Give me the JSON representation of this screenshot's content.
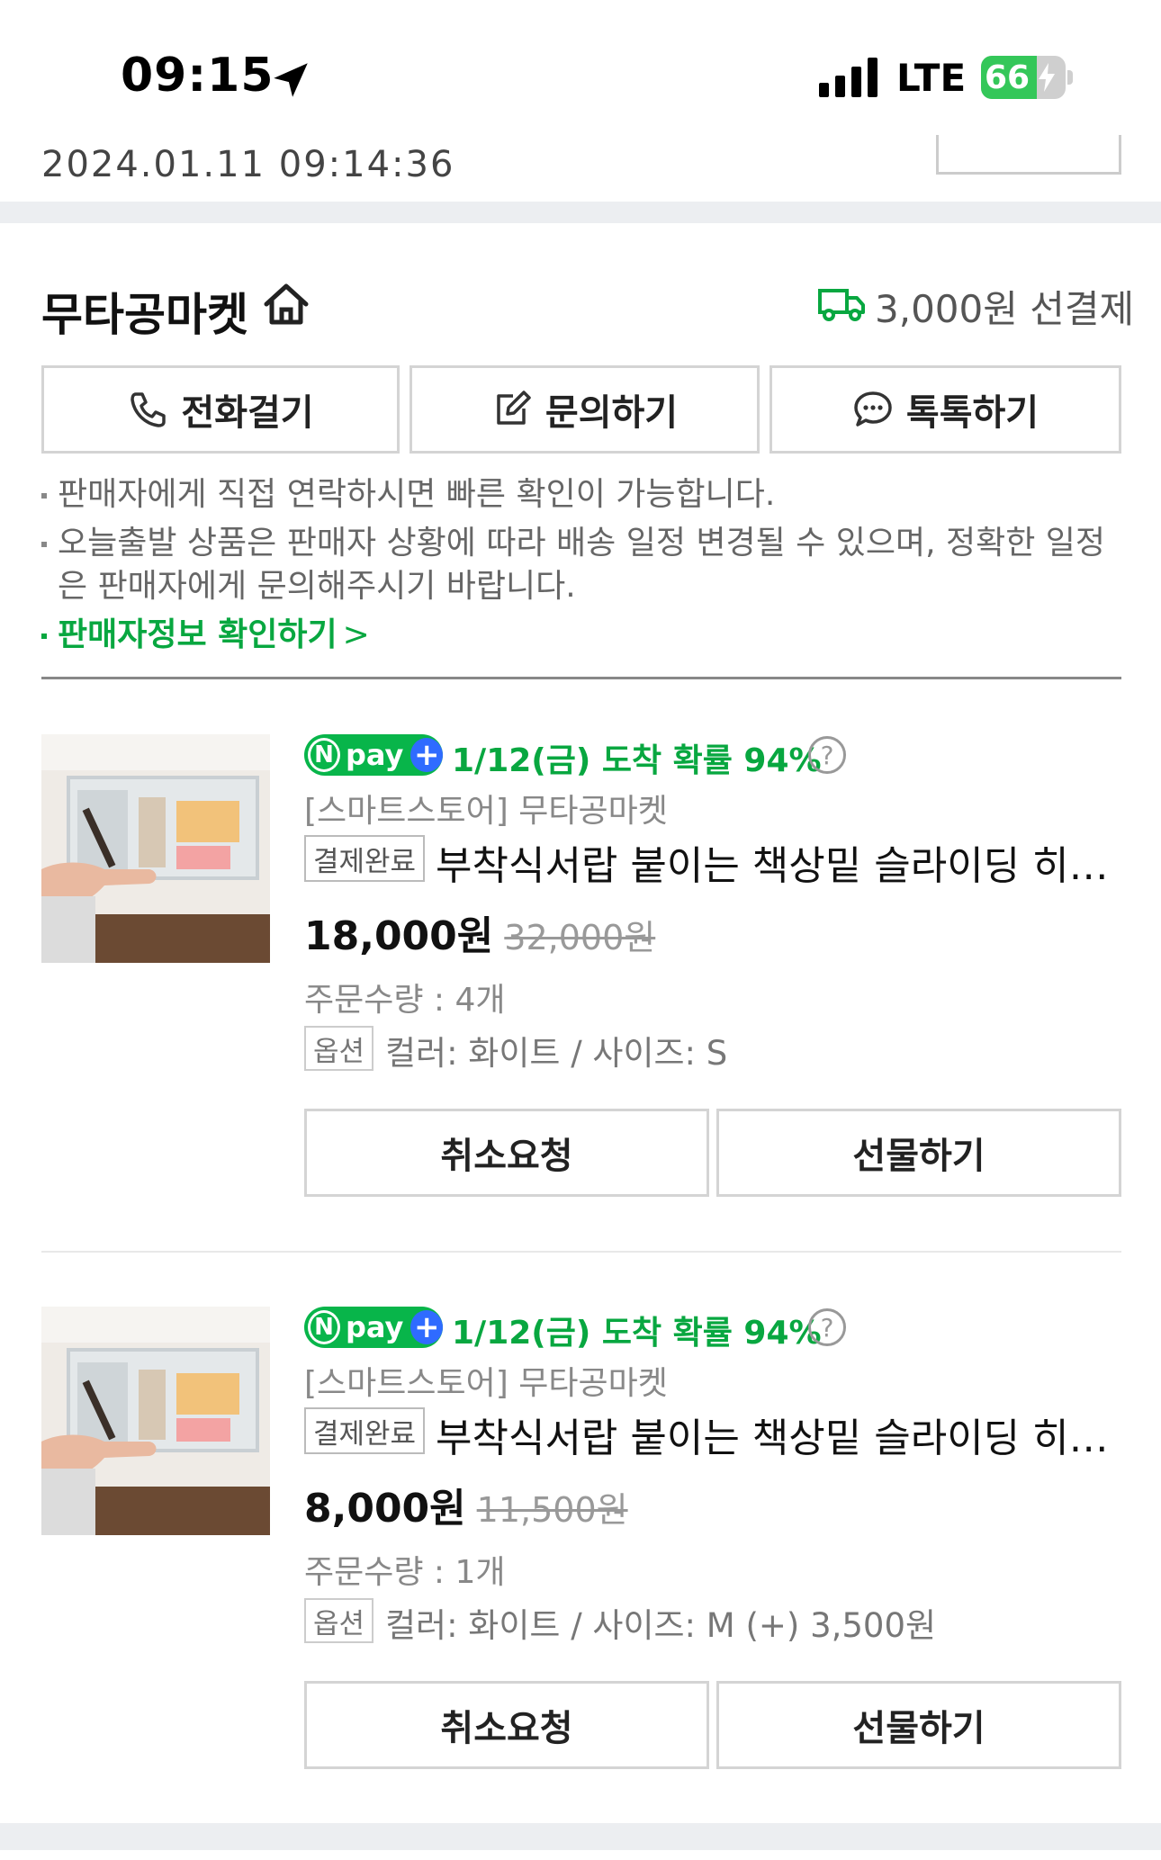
{
  "status_bar": {
    "time": "09:15",
    "network": "LTE",
    "battery": "66",
    "battery_level": 0.66
  },
  "previous": {
    "order_date": "2024.01.11 09:14:36"
  },
  "store": {
    "name": "무타공마켓",
    "shipping": "3,000원 선결제"
  },
  "contact_buttons": {
    "call": "전화걸기",
    "inquiry": "문의하기",
    "talk": "톡톡하기"
  },
  "notices": {
    "line1": "판매자에게 직접 연락하시면 빠른 확인이 가능합니다.",
    "line2a": "오늘출발 상품은 판매자 상황에 따라 배송 일정 변경될 수 있으며, 정확한 일정",
    "line2b": "은 판매자에게 문의해주시기 바랍니다.",
    "seller_info": "판매자정보 확인하기",
    "seller_info_chevron": ">"
  },
  "npay_badge": {
    "n": "N",
    "pay": "pay",
    "plus": "+"
  },
  "products": [
    {
      "arrival": "1/12(금) 도착 확률 94%",
      "help": "?",
      "store_line": "[스마트스토어] 무타공마켓",
      "status": "결제완료",
      "name": "부착식서랍 붙이는 책상밑 슬라이딩 히든 수납 서랍",
      "price": "18,000원",
      "original_price": "32,000원",
      "quantity": "주문수량 : 4개",
      "option_label": "옵션",
      "option": "컬러: 화이트 / 사이즈: S",
      "cancel": "취소요청",
      "gift": "선물하기"
    },
    {
      "arrival": "1/12(금) 도착 확률 94%",
      "help": "?",
      "store_line": "[스마트스토어] 무타공마켓",
      "status": "결제완료",
      "name": "부착식서랍 붙이는 책상밑 슬라이딩 히든 수납 서랍",
      "price": "8,000원",
      "original_price": "11,500원",
      "quantity": "주문수량 : 1개",
      "option_label": "옵션",
      "option": "컬러: 화이트 / 사이즈: M (+) 3,500원",
      "cancel": "취소요청",
      "gift": "선물하기"
    }
  ],
  "colors": {
    "brand_green": "#08a740",
    "npay_green": "#08b54a",
    "npay_blue": "#2f6bff",
    "border": "#d4d4d4"
  }
}
